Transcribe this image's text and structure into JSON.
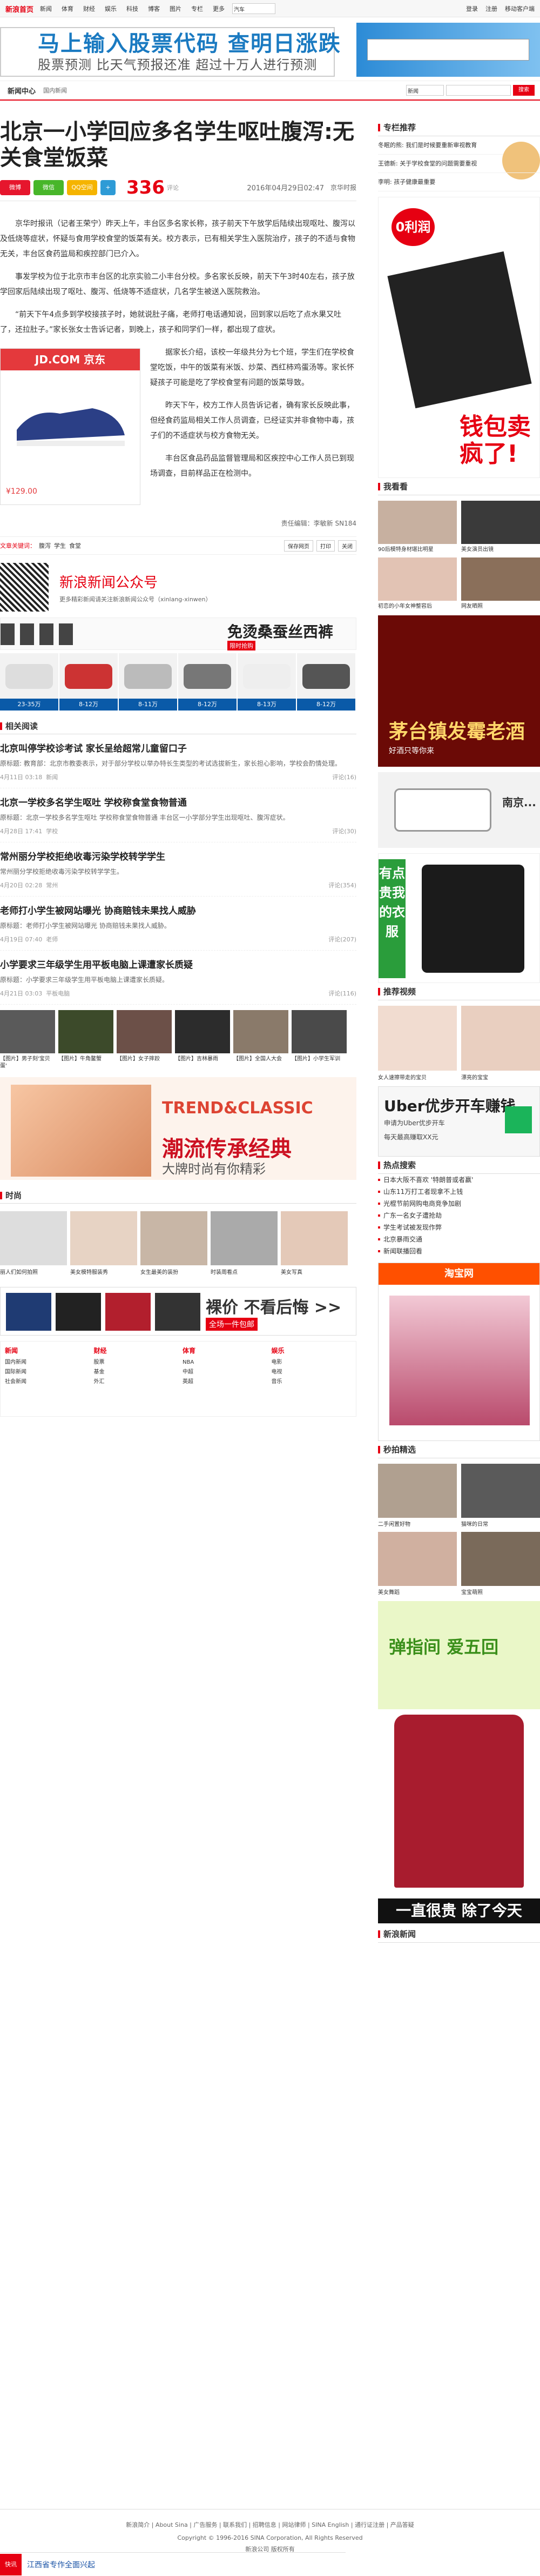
{
  "topnav": {
    "logo": "新浪首页",
    "links": [
      "新闻",
      "体育",
      "财经",
      "娱乐",
      "科技",
      "博客",
      "图片",
      "专栏",
      "更多"
    ],
    "search_placeholder": "汽车",
    "right": [
      "登录",
      "注册",
      "移动客户端"
    ]
  },
  "ad_top": {
    "title": "马上输入股票代码  查明日涨跌",
    "sub": "股票预测 比天气预报还准 超过十万人进行预测"
  },
  "channel": {
    "logo": "新闻中心",
    "crumb": "国内新闻",
    "select": "新闻",
    "search_btn": "搜索"
  },
  "article": {
    "title": "北京一小学回应多名学生呕吐腹泻:无关食堂饭菜",
    "share_labels": [
      "微博",
      "微信",
      "QQ空间"
    ],
    "comment_count": "336",
    "comment_label": "评论",
    "date": "2016年04月29日02:47",
    "source": "京华时报",
    "paragraphs": [
      "京华时报讯（记者王荣宁）昨天上午，丰台区多名家长称，孩子前天下午放学后陆续出现呕吐、腹泻以及低烧等症状，怀疑与食用学校食堂的饭菜有关。校方表示，已有相关学生入医院治疗，孩子的不适与食物无关，丰台区食药监局和疾控部门已介入。",
      "事发学校为位于北京市丰台区的北京实验二小丰台分校。多名家长反映，前天下午3时40左右，孩子放学回家后陆续出现了呕吐、腹泻、低烧等不适症状，几名学生被送入医院救治。",
      "“前天下午4点多到学校接孩子时，她就说肚子痛，老师打电话通知说，回到家以后吃了点水果又吐了，还拉肚子。”家长张女士告诉记者，到晚上，孩子和同学们一样，都出现了症状。",
      "据家长介绍，该校一年级共分为七个班，学生们在学校食堂吃饭，中午的饭菜有米饭、炒菜、西红柿鸡蛋汤等。家长怀疑孩子可能是吃了学校食堂有问题的饭菜导致。",
      "昨天下午，校方工作人员告诉记者，确有家长反映此事，但经食药监局相关工作人员调查，已经证实并非食物中毒，孩子们的不适症状与校方食物无关。",
      "丰台区食品药品监督管理局和区疾控中心工作人员已到现场调查，目前样品正在检测中。"
    ],
    "editor": "责任编辑：李敏新 SN184"
  },
  "inline_ad": {
    "brand": "JD.COM 京东",
    "price": "¥129.00",
    "tag": "7/12"
  },
  "tags": {
    "label": "文章关键词：",
    "items": [
      "腹泻",
      "学生",
      "食堂"
    ],
    "actions": [
      "保存网页",
      "打印",
      "关闭"
    ]
  },
  "wx": {
    "title": "新浪新闻公众号",
    "desc": "更多精彩新闻请关注新浪新闻公众号（xinlang-xinwen）"
  },
  "adstrip": {
    "title": "免烫桑蚕丝西裤",
    "tag": "限时抢购"
  },
  "cars": [
    {
      "label": "23-35万"
    },
    {
      "label": "8-12万"
    },
    {
      "label": "8-11万"
    },
    {
      "label": "8-12万"
    },
    {
      "label": "8-13万"
    },
    {
      "label": "8-12万"
    }
  ],
  "related_title": "相关阅读",
  "related": [
    {
      "title": "北京叫停学校诊考试 家长呈给超常儿童留口子",
      "desc": "原标题: 教育部：北京市教委表示，对于部分学校以举办特长生类型的考试选拔新生，家长担心影响，学校会酌情处理。",
      "date": "4月11日 03:18",
      "cat": "新闻",
      "comments": "评论(16)"
    },
    {
      "title": "北京一学校多名学生呕吐 学校称食堂食物普通",
      "desc": "原标题：北京一学校多名学生呕吐 学校称食堂食物普通 丰台区一小学部分学生出现呕吐、腹泻症状。",
      "date": "4月28日 17:41",
      "cat": "学校",
      "comments": "评论(30)"
    },
    {
      "title": "常州丽分学校拒绝收毒污染学校转学学生",
      "desc": "常州丽分学校拒绝收毒污染学校转学学生。",
      "date": "4月20日 02:28",
      "cat": "常州",
      "comments": "评论(354)"
    },
    {
      "title": "老师打小学生被网站曝光 协商赔钱未果找人威胁",
      "desc": "原标题：老师打小学生被网站曝光 协商赔钱未果找人威胁。",
      "date": "4月19日 07:40",
      "cat": "老师",
      "comments": "评论(207)"
    },
    {
      "title": "小学要求三年级学生用平板电脑上课遭家长质疑",
      "desc": "原标题：小学要求三年级学生用平板电脑上课遭家长质疑。",
      "date": "4月21日 03:03",
      "cat": "平板电脑",
      "comments": "评论(116)"
    }
  ],
  "photos": [
    {
      "cap": "【图片】男子刻'宝贝蛋'"
    },
    {
      "cap": "【图片】牛角鳌蟹"
    },
    {
      "cap": "【图片】女子摔跤"
    },
    {
      "cap": "【图片】吉林暴雨"
    },
    {
      "cap": "【图片】全国人大会"
    },
    {
      "cap": "【图片】小学生军训"
    }
  ],
  "banner2": {
    "t1": "TREND&CLASSIC",
    "t2": "潮流传承经典",
    "t3": "大牌时尚有你精彩"
  },
  "fashion_title": "时尚",
  "fashion": [
    {
      "cap": "丽人们如何拍照"
    },
    {
      "cap": "美女模特服装秀"
    },
    {
      "cap": "女生最美的装扮"
    },
    {
      "cap": "时装周看点"
    },
    {
      "cap": "美女写真"
    }
  ],
  "promo": {
    "t1": "裸价 不看后悔 >>",
    "t2": "全场一件包邮"
  },
  "links": [
    {
      "hd": "新闻",
      "items": [
        "国内新闻",
        "国际新闻",
        "社会新闻"
      ]
    },
    {
      "hd": "财经",
      "items": [
        "股票",
        "基金",
        "外汇"
      ]
    },
    {
      "hd": "体育",
      "items": [
        "NBA",
        "中超",
        "英超"
      ]
    },
    {
      "hd": "娱乐",
      "items": [
        "电影",
        "电视",
        "音乐"
      ]
    }
  ],
  "side": {
    "comments_title": "专栏推荐",
    "comments": [
      {
        "text": "冬眠的熊: 我们是时候要重新审视教育"
      },
      {
        "text": "王德新: 关于学校食堂的问题需要重视"
      },
      {
        "text": "李明: 孩子健康最重要"
      }
    ],
    "wallet_tag": "0利润",
    "wallet_text": "钱包卖疯了!",
    "watch_title": "我看看",
    "watch": [
      {
        "cap": "90后模特身材堪比明星"
      },
      {
        "cap": "美女演员出镜"
      },
      {
        "cap": "初恋的小年女神整容后"
      },
      {
        "cap": "网友晒照"
      }
    ],
    "maotai": {
      "t1": "茅台镇发霉老酒",
      "t2": "好酒只等你来"
    },
    "car": {
      "t": "南京..."
    },
    "shirt": {
      "v": "有点贵我的衣服"
    },
    "recommend_title": "推荐视频",
    "recommend": [
      {
        "cap": "女人速擦带走的宝贝"
      },
      {
        "cap": "漂亮的宝宝"
      }
    ],
    "uber": {
      "t1": "Uber优步开车赚钱",
      "t2": "申请为Uber优步开车",
      "t3": "每天最高赚取XX元"
    },
    "hot_title": "热点搜索",
    "hot": [
      "日本大阪不喜欢 '特朗普或者赢'",
      "山东11万打工者现拿不上钱",
      "光棍节前网购电商竞争加剧",
      "广东一名女子遭抢劫",
      "学生考试被发现作弊",
      "北京暴雨交通",
      "新闻联播回看"
    ],
    "taobao": "淘宝网",
    "small_title": "秒拍精选",
    "small": [
      {
        "cap": "二手闲置好物"
      },
      {
        "cap": "猫咪的日常"
      },
      {
        "cap": "美女舞蹈"
      },
      {
        "cap": "宝宝萌照"
      }
    ],
    "green": "弹指间 爱五回",
    "bigshirt": "一直很贵 除了今天",
    "new_title": "新浪新闻"
  },
  "footer": {
    "links": "新浪简介 | About Sina | 广告服务 | 联系我们 | 招聘信息 | 网站律师 | SINA English | 通行证注册 | 产品答疑",
    "copyright": "Copyright © 1996-2016 SINA Corporation, All Rights Reserved",
    "company": "新浪公司 版权所有"
  },
  "bottombar": {
    "label": "快讯",
    "text": "江西省专作全面兴起"
  }
}
